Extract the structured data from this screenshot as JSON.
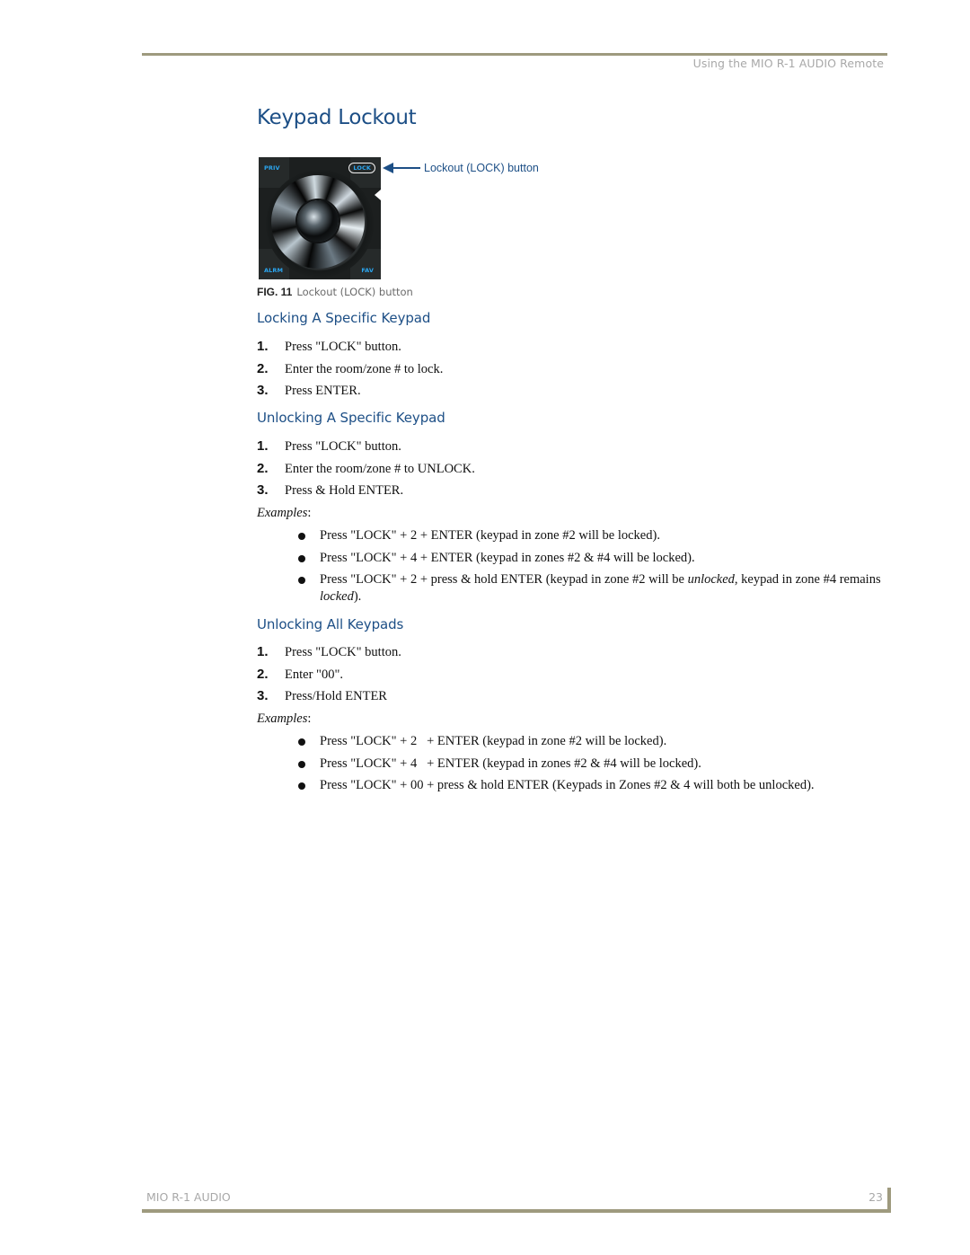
{
  "header": {
    "running_head": "Using the MIO R-1 AUDIO Remote"
  },
  "title": "Keypad Lockout",
  "figure": {
    "keys": {
      "top_left": "PRIV",
      "top_right": "LOCK",
      "bottom_left": "ALRM",
      "bottom_right": "FAV"
    },
    "callout": "Lockout (LOCK) button",
    "caption_label": "FIG. 11",
    "caption_text": "Lockout (LOCK) button"
  },
  "sections": [
    {
      "heading": "Locking A Specific Keypad",
      "steps": [
        {
          "num": "1.",
          "text": "Press \"LOCK\" button."
        },
        {
          "num": "2.",
          "text": "Enter the room/zone # to lock."
        },
        {
          "num": "3.",
          "text": "Press ENTER."
        }
      ]
    },
    {
      "heading": "Unlocking A Specific Keypad",
      "steps": [
        {
          "num": "1.",
          "text": "Press \"LOCK\" button."
        },
        {
          "num": "2.",
          "text": "Enter the room/zone # to UNLOCK."
        },
        {
          "num": "3.",
          "text": "Press & Hold ENTER."
        }
      ],
      "examples_label": "Examples",
      "examples": [
        {
          "text": "Press \"LOCK\" + 2 + ENTER (keypad in zone #2 will be locked)."
        },
        {
          "text": "Press \"LOCK\" + 4 + ENTER (keypad in zones #2 & #4 will be locked)."
        },
        {
          "pre": "Press \"LOCK\" + 2 + press & hold ENTER (keypad in zone #2 will be ",
          "em1": "unlocked",
          "mid": ", keypad in zone #4 remains ",
          "em2": "locked",
          "post": ")."
        }
      ]
    },
    {
      "heading": "Unlocking All Keypads",
      "steps": [
        {
          "num": "1.",
          "text": "Press \"LOCK\" button."
        },
        {
          "num": "2.",
          "text": "Enter \"00\"."
        },
        {
          "num": "3.",
          "text": "Press/Hold ENTER"
        }
      ],
      "examples_label": "Examples",
      "examples": [
        {
          "text": "Press \"LOCK\" + 2   + ENTER (keypad in zone #2 will be locked)."
        },
        {
          "text": "Press \"LOCK\" + 4   + ENTER (keypad in zones #2 & #4 will be locked)."
        },
        {
          "text": "Press \"LOCK\" + 00 + press & hold ENTER (Keypads in Zones #2 & 4 will both be unlocked)."
        }
      ]
    }
  ],
  "footer": {
    "product": "MIO R-1 AUDIO",
    "page_number": "23"
  },
  "colors": {
    "heading_blue": "#1d4f86",
    "rule_olive": "#9e9a7e",
    "key_blue": "#2ba6f0"
  }
}
